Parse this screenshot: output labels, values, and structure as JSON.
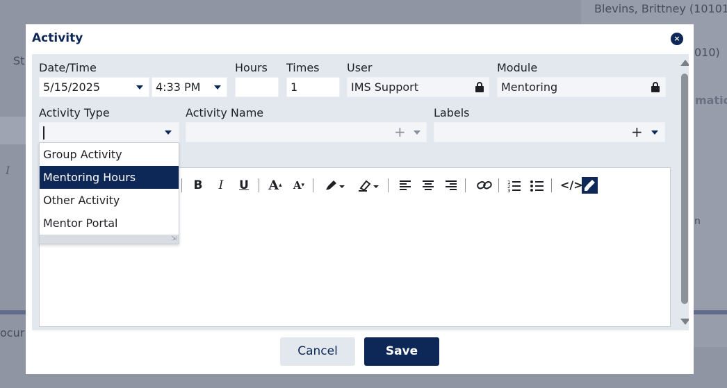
{
  "background": {
    "top_right_name": "Blevins, Brittney (10101)",
    "right_partial_1": "010)",
    "right_partial_2": "matio",
    "right_partial_3": "n",
    "left_partial_1": "St",
    "left_partial_2": "ocur",
    "left_italic": "I"
  },
  "modal": {
    "title": "Activity",
    "close_label": "×"
  },
  "form": {
    "date_label": "Date/Time",
    "date_value": "5/15/2025",
    "time_value": "4:33 PM",
    "hours_label": "Hours",
    "hours_value": "",
    "times_label": "Times",
    "times_value": "1",
    "user_label": "User",
    "user_value": "IMS Support",
    "module_label": "Module",
    "module_value": "Mentoring",
    "activity_type_label": "Activity Type",
    "activity_type_value": "",
    "activity_name_label": "Activity Name",
    "activity_name_value": "",
    "labels_label": "Labels",
    "labels_value": ""
  },
  "dropdown": {
    "items": [
      {
        "label": "Group Activity",
        "selected": false
      },
      {
        "label": "Mentoring Hours",
        "selected": true
      },
      {
        "label": "Other Activity",
        "selected": false
      },
      {
        "label": "Mentor Portal",
        "selected": false
      }
    ],
    "grip": "⇲"
  },
  "toolbar": {
    "bold": "B",
    "italic": "I",
    "underline": "U",
    "font_increase": "A",
    "font_decrease": "A",
    "source": "</>"
  },
  "footer": {
    "cancel_label": "Cancel",
    "save_label": "Save"
  },
  "colors": {
    "primary": "#0d2756",
    "form_bg": "#e3e8ef",
    "selected_bg": "#0d2756"
  }
}
